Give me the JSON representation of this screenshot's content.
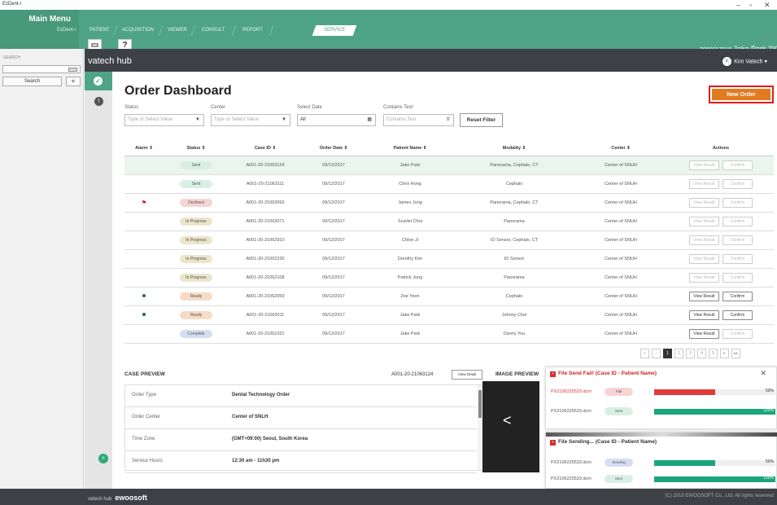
{
  "window": {
    "app_name": "EzDent-i",
    "minimize": "–",
    "maximize": "▫",
    "close": "✕"
  },
  "main_menu": {
    "title": "Main Menu",
    "subtitle": "EzDent-i"
  },
  "tabs": [
    "PATIENT",
    "ACQUISITION",
    "VIEWER",
    "CONSULT",
    "REPORT",
    "SERVICE"
  ],
  "active_tab": "SERVICE",
  "toolbar": {
    "help": "?"
  },
  "patient": {
    "id": "2089017018",
    "name": "Jake Park 2Y"
  },
  "search": {
    "label": "SEARCH",
    "value": "",
    "button": "Search",
    "add": "+"
  },
  "hub": {
    "name": "vatech hub",
    "user": "Kim Vatech",
    "user_initial": "K"
  },
  "dashboard": {
    "title": "Order Dashboard",
    "new_order": "New Order"
  },
  "filters": {
    "status": {
      "label": "Status",
      "placeholder": "Type or Select Value"
    },
    "center": {
      "label": "Center",
      "placeholder": "Type or Select Value"
    },
    "date": {
      "label": "Select Date",
      "value": "All"
    },
    "text": {
      "label": "Contains Text",
      "placeholder": "Contains Text"
    },
    "reset": "Reset Filter"
  },
  "table": {
    "headers": [
      "Alarm ⇕",
      "Status ⇕",
      "Case ID ⇕",
      "Order Date ⇕",
      "Patient Name ⇕",
      "Modality ⇕",
      "Center ⇕",
      "Actions"
    ],
    "rows": [
      {
        "alarm": "",
        "status": "Sent",
        "case": "A001-20-21063124",
        "date": "09/12/2017",
        "patient": "Jake Park",
        "modality": "Panorama, Cephalo, CT",
        "center": "Center of SNUH",
        "view": "View Result",
        "confirm": "Confirm"
      },
      {
        "alarm": "",
        "status": "Sent",
        "case": "A001-20-21063111",
        "date": "09/12/2017",
        "patient": "Chris Hong",
        "modality": "Cephalo",
        "center": "Center of SNUH",
        "view": "View Result",
        "confirm": "Confirm"
      },
      {
        "alarm": "flag",
        "status": "Declined",
        "case": "A001-20-21063093",
        "date": "09/12/2017",
        "patient": "James Jung",
        "modality": "Panorama, Cephalo, CT",
        "center": "Center of SNUH",
        "view": "View Result",
        "confirm": "Confirm"
      },
      {
        "alarm": "",
        "status": "In Progress",
        "case": "A001-20-21063071",
        "date": "09/12/2017",
        "patient": "Scarlet Choi",
        "modality": "Panorama",
        "center": "Center of SNUH",
        "view": "View Result",
        "confirm": "Confirm"
      },
      {
        "alarm": "",
        "status": "In Progress",
        "case": "A001-20-21062910",
        "date": "09/12/2017",
        "patient": "Chloe Ji",
        "modality": "IO Sensor, Cephalo, CT",
        "center": "Center of SNUH",
        "view": "View Result",
        "confirm": "Confirm"
      },
      {
        "alarm": "",
        "status": "In Progress",
        "case": "A001-20-21062230",
        "date": "09/12/2017",
        "patient": "Dorothy Kim",
        "modality": "IO Sensor",
        "center": "Center of SNUH",
        "view": "View Result",
        "confirm": "Confirm"
      },
      {
        "alarm": "",
        "status": "In Progress",
        "case": "A001-20-21062108",
        "date": "09/12/2017",
        "patient": "Patrick Jung",
        "modality": "Panorama",
        "center": "Center of SNUH",
        "view": "View Result",
        "confirm": "Confirm"
      },
      {
        "alarm": "dot",
        "status": "Ready",
        "case": "A001-20-21062059",
        "date": "09/12/2017",
        "patient": "Zoe Yeon",
        "modality": "Cephalo",
        "center": "Center of SNUH",
        "view": "View Result",
        "confirm": "Confirm"
      },
      {
        "alarm": "dot",
        "status": "Ready",
        "case": "A001-20-21062011",
        "date": "09/12/2017",
        "patient": "Jake Park",
        "modality": "Johnny Choi",
        "center": "Center of SNUH",
        "view": "View Result",
        "confirm": "Confirm"
      },
      {
        "alarm": "",
        "status": "Complete",
        "case": "A001-20-21061031",
        "date": "09/12/2017",
        "patient": "Jake Park",
        "modality": "Danny You",
        "center": "Center of SNUH",
        "view": "View Result",
        "confirm": "Confirm"
      }
    ]
  },
  "pager": {
    "first": "«",
    "prev": "‹",
    "pages": [
      "1",
      "2",
      "3",
      "4",
      "5"
    ],
    "current": "1",
    "next": "▸",
    "last": "▸▸"
  },
  "case_preview": {
    "title": "CASE PREVIEW",
    "case_id": "A001-20-21063124",
    "view_detail": "View Detail",
    "rows": [
      {
        "key": "Order Type",
        "value": "Dental Technology Order"
      },
      {
        "key": "Order Center",
        "value": "Center of SNLH"
      },
      {
        "key": "Time Zone",
        "value": "(GMT+09:00) Seoul, South Korea"
      },
      {
        "key": "Service Hours",
        "value": "12:30 am - 11h30 pm"
      }
    ]
  },
  "image_preview": {
    "title": "IMAGE PREVIEW"
  },
  "popup_fail": {
    "title": "File Send Fail! (Case ID - Patient Name)",
    "close": "✕",
    "rows": [
      {
        "file": "PX2106225533.dcm",
        "status": "Fail",
        "progress": 0.5,
        "pct": "50%"
      },
      {
        "file": "PX2106225533.dcm",
        "status": "Sent",
        "progress": 1.0,
        "pct": "100%"
      }
    ]
  },
  "popup_sending": {
    "title": "File Sending... (Case ID - Patient Name)",
    "rows": [
      {
        "file": "PX2106225533.dcm",
        "status": "Sending",
        "progress": 0.5,
        "pct": "50%"
      },
      {
        "file": "PX2106225533.dcm",
        "status": "Sent",
        "progress": 1.0,
        "pct": "100%"
      }
    ]
  },
  "footer": {
    "hub": "vatech hub",
    "brand": "ewoosoft",
    "copyright": "(C) 2018 EWOOSOFT Co., Ltd. All rights reserved"
  },
  "colors": {
    "primary": "#4fa487",
    "new_order": "#e07b1f",
    "highlight": "#e41a1a",
    "fail_bar": "#e03a3a",
    "ok_bar": "#1ba57b",
    "dark": "#3d4146"
  }
}
